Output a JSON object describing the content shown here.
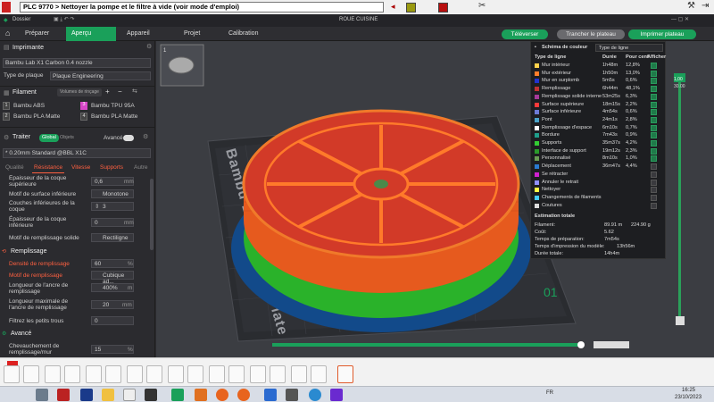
{
  "plcbar": {
    "selected": "PLC 9770 >  Nettoyer la pompe et le filtre à vide (voir mode d'emploi)"
  },
  "titlebar": {
    "dossier": "Dossier",
    "title": "ROUE CUISINE"
  },
  "nav": {
    "tabs": [
      {
        "label": "Préparer"
      },
      {
        "label": "Aperçu"
      },
      {
        "label": "Appareil"
      },
      {
        "label": "Projet"
      },
      {
        "label": "Calibration"
      }
    ],
    "buttons": {
      "upload": "Téléverser",
      "slice": "Trancher le plateau",
      "print": "Imprimer plateau"
    }
  },
  "left": {
    "printer_title": "Imprimante",
    "printer_name": "Bambu Lab X1 Carbon 0.4 nozzle",
    "plate_label": "Type de plaque",
    "plate_value": "Plaque Engineering",
    "filament_title": "Filament",
    "filament_btn": "Volumes de rinçage",
    "filaments": [
      {
        "n": "1",
        "name": "Bambu ABS",
        "color": "#3c3c3c"
      },
      {
        "n": "3",
        "name": "Bambu TPU 95A",
        "color": "#d946c8"
      },
      {
        "n": "2",
        "name": "Bambu PLA Matte",
        "color": "#3c3c3c"
      },
      {
        "n": "4",
        "name": "Bambu PLA Matte",
        "color": "#3c3c3c"
      }
    ],
    "process_title": "Traiter",
    "global": "Global",
    "objet": "Objets",
    "advanced": "Avancé",
    "profile": "* 0.20mm Standard @BBL X1C",
    "process_tabs": [
      "Qualité",
      "Résistance",
      "Vitesse",
      "Supports",
      "Autre"
    ],
    "rows": [
      {
        "label": "Épaisseur de la coque supérieure",
        "value": "0,6",
        "unit": "mm"
      },
      {
        "label": "Motif de surface inférieure",
        "value": "Monotone"
      },
      {
        "label": "Couches inférieures de la coque",
        "value": "3"
      },
      {
        "label": "Épaisseur de la coque inférieure",
        "value": "0",
        "unit": "mm"
      },
      {
        "label": "Motif de remplissage solide",
        "value": "Rectiligne"
      }
    ],
    "remplissage_title": "Remplissage",
    "remplissage_rows": [
      {
        "label": "Densité de remplissage",
        "value": "60",
        "unit": "%"
      },
      {
        "label": "Motif de remplissage",
        "value": "Cubique ad..."
      },
      {
        "label": "Longueur de l'ancre de remplissage",
        "value": "400%",
        "unit": "m"
      },
      {
        "label": "Longueur maximale de l'ancre de remplissage",
        "value": "20",
        "unit": "mm"
      },
      {
        "label": "Filtrez les petits trous",
        "value": "0"
      }
    ],
    "avance_title": "Avancé",
    "avance_rows": [
      {
        "label": "Chevauchement de remplissage/mur",
        "value": "15",
        "unit": "%"
      }
    ]
  },
  "legend": {
    "scheme_label": "Schéma de couleur",
    "scheme_value": "Type de ligne",
    "headers": [
      "Type de ligne",
      "Durée",
      "Pour cent",
      "Afficher"
    ],
    "rows": [
      {
        "name": "Mur intérieur",
        "dur": "1h48m",
        "pct": "12,8%",
        "color": "#ffd24a",
        "on": true
      },
      {
        "name": "Mur extérieur",
        "dur": "1h50m",
        "pct": "13,0%",
        "color": "#ff7d2a",
        "on": true
      },
      {
        "name": "Mur en surplomb",
        "dur": "5m5s",
        "pct": "0,6%",
        "color": "#2233cc",
        "on": true
      },
      {
        "name": "Remplissage",
        "dur": "6h44m",
        "pct": "48,1%",
        "color": "#c23232",
        "on": true
      },
      {
        "name": "Remplissage solide interne",
        "dur": "53m25s",
        "pct": "6,3%",
        "color": "#a63a9a",
        "on": true
      },
      {
        "name": "Surface supérieure",
        "dur": "18m15s",
        "pct": "2,2%",
        "color": "#ff3a3a",
        "on": true
      },
      {
        "name": "Surface inférieure",
        "dur": "4m54s",
        "pct": "0,6%",
        "color": "#6d7bd6",
        "on": true
      },
      {
        "name": "Pont",
        "dur": "24m1s",
        "pct": "2,8%",
        "color": "#4aa3c8",
        "on": true
      },
      {
        "name": "Remplissage d'espace",
        "dur": "6m10s",
        "pct": "0,7%",
        "color": "#ffffff",
        "on": true
      },
      {
        "name": "Bordure",
        "dur": "7m43s",
        "pct": "0,9%",
        "color": "#1f9e8a",
        "on": true
      },
      {
        "name": "Supports",
        "dur": "35m37s",
        "pct": "4,2%",
        "color": "#33cc33",
        "on": true
      },
      {
        "name": "Interface de support",
        "dur": "19m12s",
        "pct": "2,3%",
        "color": "#2a9a2a",
        "on": true
      },
      {
        "name": "Personnalisé",
        "dur": "8m10s",
        "pct": "1,0%",
        "color": "#6a9c54",
        "on": true
      },
      {
        "name": "Déplacement",
        "dur": "36m47s",
        "pct": "4,4%",
        "color": "#2a7ad0",
        "on": false
      },
      {
        "name": "Se rétracter",
        "dur": "",
        "pct": "",
        "color": "#d020d0",
        "on": false
      },
      {
        "name": "Annuler le retrait",
        "dur": "",
        "pct": "",
        "color": "#9090ff",
        "on": false
      },
      {
        "name": "Nettoyer",
        "dur": "",
        "pct": "",
        "color": "#ffff44",
        "on": false
      },
      {
        "name": "Changements de filaments",
        "dur": "",
        "pct": "",
        "color": "#44ccff",
        "on": false
      },
      {
        "name": "Coutures",
        "dur": "",
        "pct": "",
        "color": "#dddddd",
        "on": false
      }
    ],
    "estimation_title": "Estimation totale",
    "est_rows": [
      {
        "label": "Filament:",
        "v1": "89.91 m",
        "v2": "224.90 g"
      },
      {
        "label": "Coût:",
        "v1": "5.62",
        "v2": ""
      },
      {
        "label": "Temps de préparation:",
        "v1": "7m54s",
        "v2": ""
      },
      {
        "label": "Temps d'impression du modèle:",
        "v1": "13h56m",
        "v2": ""
      },
      {
        "label": "Durée totale:",
        "v1": "14h4m",
        "v2": ""
      }
    ]
  },
  "viewport": {
    "plate_text": "Bambu Engineering Plate",
    "plate_number": "01",
    "layer_top": "1,00",
    "layer_top_sub": "30.00",
    "thumb_index": "1"
  },
  "taskbar": {
    "time": "16:25",
    "date": "23/10/2023",
    "lang": "FR"
  }
}
